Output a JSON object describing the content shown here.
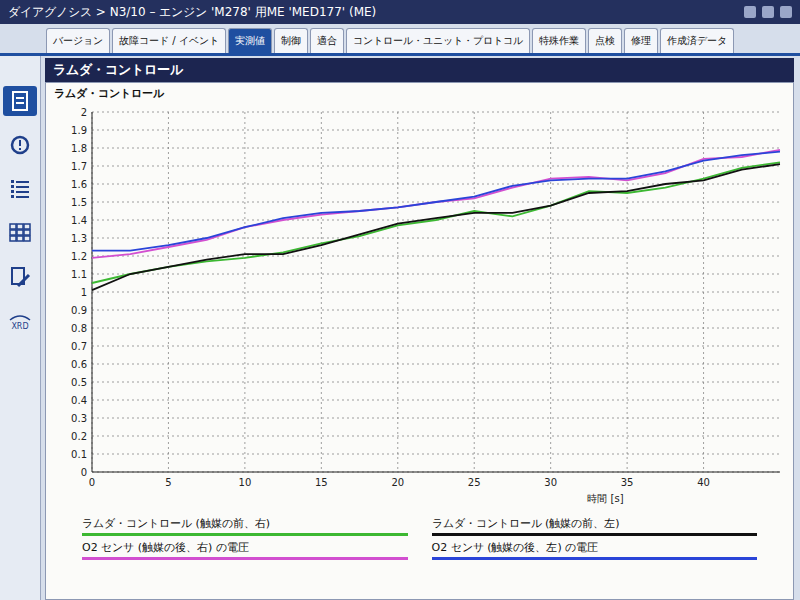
{
  "window": {
    "breadcrumb": "ダイアグノシス > N3/10 – エンジン 'M278' 用ME 'MED177' (ME)"
  },
  "tabs": [
    {
      "label": "バージョン",
      "selected": false
    },
    {
      "label": "故障コード / イベント",
      "selected": false
    },
    {
      "label": "実測値",
      "selected": true
    },
    {
      "label": "制御",
      "selected": false
    },
    {
      "label": "適合",
      "selected": false
    },
    {
      "label": "コントロール・ユニット・プロトコル",
      "selected": false
    },
    {
      "label": "特殊作業",
      "selected": false
    },
    {
      "label": "点検",
      "selected": false
    },
    {
      "label": "修理",
      "selected": false
    },
    {
      "label": "作成済データ",
      "selected": false
    }
  ],
  "panel": {
    "title": "ラムダ・コントロール"
  },
  "sidebar": {
    "items": [
      {
        "kind": "document",
        "label": "",
        "selected": true
      },
      {
        "kind": "alert",
        "label": "",
        "selected": false
      },
      {
        "kind": "list",
        "label": "",
        "selected": false
      },
      {
        "kind": "grid",
        "label": "",
        "selected": false
      },
      {
        "kind": "tool",
        "label": "",
        "selected": false
      },
      {
        "kind": "xrd",
        "label": "XRD",
        "selected": false
      }
    ]
  },
  "chart": {
    "title": "ラムダ・コントロール",
    "y_ticks": [
      "0",
      "0.1",
      "0.2",
      "0.3",
      "0.4",
      "0.5",
      "0.6",
      "0.7",
      "0.8",
      "0.9",
      "1",
      "1.1",
      "1.2",
      "1.3",
      "1.4",
      "1.5",
      "1.6",
      "1.7",
      "1.8",
      "1.9",
      "2"
    ],
    "x_ticks": [
      "0",
      "5",
      "10",
      "15",
      "20",
      "25",
      "30",
      "35",
      "40"
    ],
    "x_label": "時間 [s]",
    "times": [
      0,
      2.5,
      5,
      7.5,
      10,
      12.5,
      15,
      17.5,
      20,
      22.5,
      25,
      27.5,
      30,
      32.5,
      35,
      37.5,
      40,
      42.5,
      45
    ],
    "series": [
      {
        "name": "ラムダ・コントロール (触媒の前、右)",
        "color": "#3cb832",
        "values": [
          1.05,
          1.1,
          1.14,
          1.17,
          1.19,
          1.22,
          1.27,
          1.31,
          1.37,
          1.4,
          1.45,
          1.42,
          1.48,
          1.56,
          1.55,
          1.58,
          1.63,
          1.69,
          1.72
        ]
      },
      {
        "name": "ラムダ・コントロール (触媒の前、左)",
        "color": "#111111",
        "values": [
          1.01,
          1.1,
          1.14,
          1.18,
          1.21,
          1.21,
          1.26,
          1.32,
          1.38,
          1.41,
          1.44,
          1.44,
          1.48,
          1.55,
          1.56,
          1.6,
          1.62,
          1.68,
          1.71
        ]
      },
      {
        "name": "O2 センサ (触媒の後、右) の電圧",
        "color": "#d24fd0",
        "values": [
          1.19,
          1.21,
          1.25,
          1.29,
          1.36,
          1.4,
          1.43,
          1.45,
          1.47,
          1.5,
          1.52,
          1.58,
          1.63,
          1.64,
          1.62,
          1.66,
          1.74,
          1.75,
          1.79
        ]
      },
      {
        "name": "O2 センサ (触媒の後、左) の電圧",
        "color": "#2a44d8",
        "values": [
          1.23,
          1.23,
          1.26,
          1.3,
          1.36,
          1.41,
          1.44,
          1.45,
          1.47,
          1.5,
          1.53,
          1.59,
          1.62,
          1.63,
          1.63,
          1.67,
          1.73,
          1.76,
          1.78
        ]
      }
    ]
  }
}
